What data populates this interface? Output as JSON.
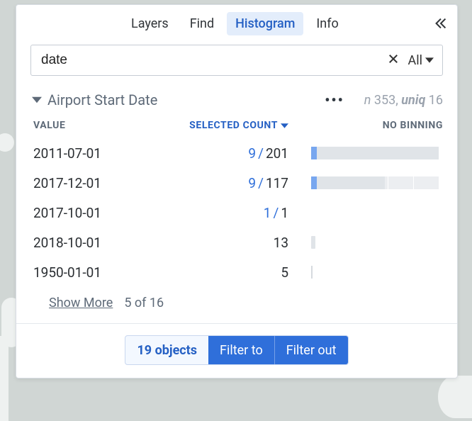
{
  "tabs": {
    "layers": "Layers",
    "find": "Find",
    "histogram": "Histogram",
    "info": "Info"
  },
  "search": {
    "value": "date",
    "scope": "All"
  },
  "property": {
    "name": "Airport Start Date",
    "n_label": "n",
    "n_value": "353",
    "uniq_label": "uniq",
    "uniq_value": "16"
  },
  "columns": {
    "value": "VALUE",
    "selected": "SELECTED COUNT",
    "binning": "NO BINNING"
  },
  "rows": [
    {
      "value": "2011-07-01",
      "selected": "9",
      "total": "201",
      "sel_pct": 4.5,
      "tot_pct": 100,
      "show_track": true
    },
    {
      "value": "2017-12-01",
      "selected": "9",
      "total": "117",
      "sel_pct": 4.5,
      "tot_pct": 58,
      "show_track": true
    },
    {
      "value": "2017-10-01",
      "selected": "1",
      "total": "1",
      "sel_pct": 0,
      "tot_pct": 0,
      "show_track": false
    },
    {
      "value": "2018-10-01",
      "selected": "",
      "total": "13",
      "sel_pct": 0,
      "tot_pct": 0,
      "show_track": false,
      "tiny": "bar"
    },
    {
      "value": "1950-01-01",
      "selected": "",
      "total": "5",
      "sel_pct": 0,
      "tot_pct": 0,
      "show_track": false,
      "tiny": "line"
    }
  ],
  "show_more": {
    "label": "Show More",
    "count": "5 of 16"
  },
  "footer": {
    "objects": "19 objects",
    "filter_to": "Filter to",
    "filter_out": "Filter out"
  }
}
